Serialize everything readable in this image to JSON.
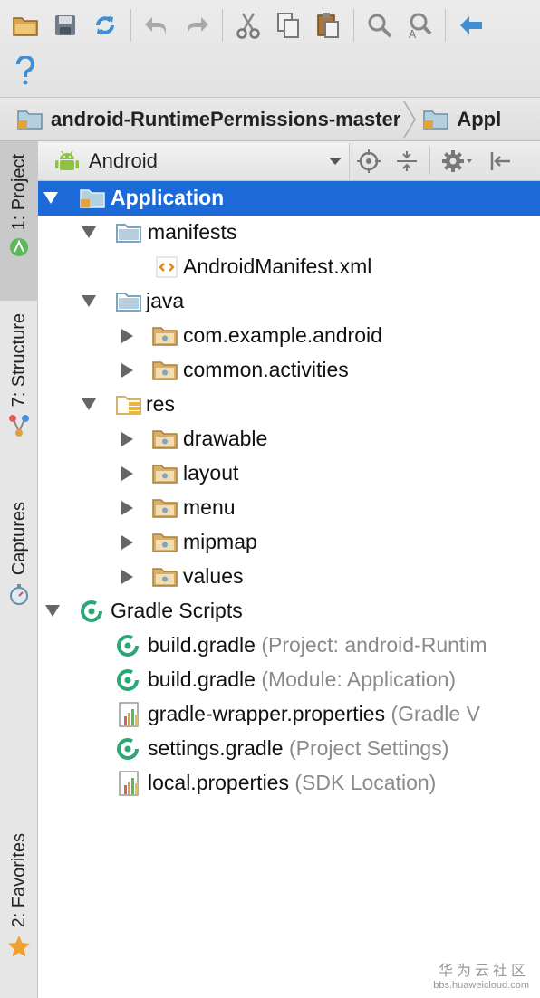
{
  "toolbar": {
    "row1": [
      "open-folder-icon",
      "save-icon",
      "sync-icon",
      "undo-icon",
      "redo-icon",
      "cut-icon",
      "copy-icon",
      "paste-icon",
      "find-icon",
      "replace-icon",
      "back-icon"
    ],
    "row2": [
      "help-icon"
    ]
  },
  "breadcrumb": {
    "items": [
      "android-RuntimePermissions-master",
      "Appl"
    ]
  },
  "strip": {
    "project": "1: Project",
    "structure": "7: Structure",
    "captures": "Captures",
    "favorites": "2: Favorites"
  },
  "panel": {
    "view_mode": "Android"
  },
  "tree": [
    {
      "label": "Application",
      "hint": "",
      "expanded": true,
      "selected": true
    },
    {
      "label": "manifests",
      "hint": "",
      "expanded": true
    },
    {
      "label": "AndroidManifest.xml",
      "hint": ""
    },
    {
      "label": "java",
      "hint": "",
      "expanded": true
    },
    {
      "label": "com.example.android",
      "hint": "",
      "expanded": false
    },
    {
      "label": "common.activities",
      "hint": "",
      "expanded": false
    },
    {
      "label": "res",
      "hint": "",
      "expanded": true
    },
    {
      "label": "drawable",
      "hint": "",
      "expanded": false
    },
    {
      "label": "layout",
      "hint": "",
      "expanded": false
    },
    {
      "label": "menu",
      "hint": "",
      "expanded": false
    },
    {
      "label": "mipmap",
      "hint": "",
      "expanded": false
    },
    {
      "label": "values",
      "hint": "",
      "expanded": false
    },
    {
      "label": "Gradle Scripts",
      "hint": "",
      "expanded": true
    },
    {
      "label": "build.gradle",
      "hint": "(Project: android-Runtim"
    },
    {
      "label": "build.gradle",
      "hint": "(Module: Application)"
    },
    {
      "label": "gradle-wrapper.properties",
      "hint": "(Gradle V"
    },
    {
      "label": "settings.gradle",
      "hint": "(Project Settings)"
    },
    {
      "label": "local.properties",
      "hint": "(SDK Location)"
    }
  ],
  "colors": {
    "selection": "#1b6ad8",
    "folder_blue": "#7aa6c2",
    "folder_tan": "#d9b06a",
    "gradle_green": "#2aa875",
    "android_green": "#8ec43d"
  },
  "watermark": {
    "line1": "华为云社区",
    "line2": "bbs.huaweicloud.com"
  }
}
